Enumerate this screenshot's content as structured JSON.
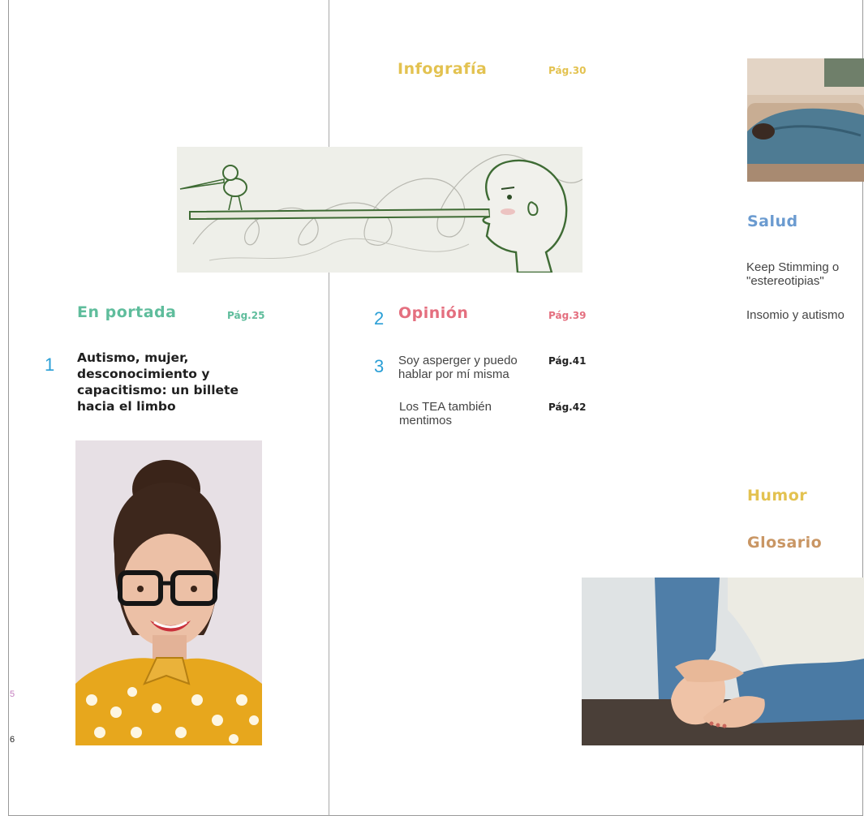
{
  "colors": {
    "teal": "#5fbd9c",
    "yellow": "#e3c250",
    "pink": "#e46f7f",
    "blue": "#6b9bd0",
    "brown": "#c99664",
    "number_blue": "#2a9fd6"
  },
  "infografia": {
    "title": "Infografía",
    "page": "Pág.30"
  },
  "en_portada": {
    "title": "En portada",
    "page": "Pág.25",
    "number": "1",
    "headline": "Autismo, mujer, desconocimiento y capacitismo: un billete hacia el limbo"
  },
  "opinion": {
    "number": "2",
    "title": "Opinión",
    "page": "Pág.39",
    "items": [
      {
        "number": "3",
        "text": "Soy asperger y puedo hablar por mí misma",
        "page": "Pág.41"
      },
      {
        "number": "",
        "text": "Los TEA también mentimos",
        "page": "Pág.42"
      }
    ]
  },
  "salud": {
    "title": "Salud",
    "items": [
      {
        "text": "Keep Stimming o \"estereotipias\""
      },
      {
        "text": "Insomio y autismo"
      }
    ]
  },
  "humor": {
    "title": "Humor"
  },
  "glosario": {
    "title": "Glosario"
  },
  "margin_marks": [
    "5",
    "6"
  ],
  "images": {
    "illustration": "pinocchio-nose-illustration",
    "portrait": "woman-glasses-portrait-photo",
    "sleeping": "person-sleeping-on-sofa-photo",
    "feet": "person-holding-feet-photo"
  }
}
